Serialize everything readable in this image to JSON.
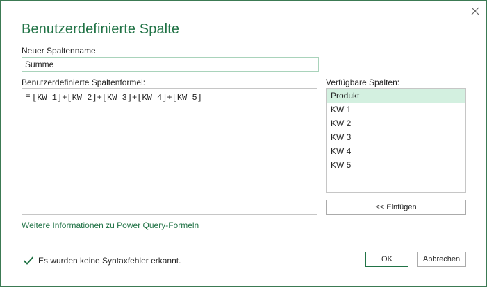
{
  "dialog": {
    "title": "Benutzerdefinierte Spalte",
    "close_icon": "close-icon"
  },
  "name_field": {
    "label": "Neuer Spaltenname",
    "value": "Summe"
  },
  "formula": {
    "label": "Benutzerdefinierte Spaltenformel:",
    "prefix": "=",
    "text": "[KW 1]+[KW 2]+[KW 3]+[KW 4]+[KW 5]"
  },
  "available_columns": {
    "label": "Verfügbare Spalten:",
    "items": [
      "Produkt",
      "KW 1",
      "KW 2",
      "KW 3",
      "KW 4",
      "KW 5"
    ],
    "selected": "Produkt",
    "insert_button": "<< Einfügen"
  },
  "help_link": "Weitere Informationen zu Power Query-Formeln",
  "status": {
    "icon": "checkmark-icon",
    "text": "Es wurden keine Syntaxfehler erkannt."
  },
  "buttons": {
    "ok": "OK",
    "cancel": "Abbrechen"
  },
  "colors": {
    "accent": "#217346",
    "selection": "#d3f0e0",
    "border": "#3c7a54"
  }
}
